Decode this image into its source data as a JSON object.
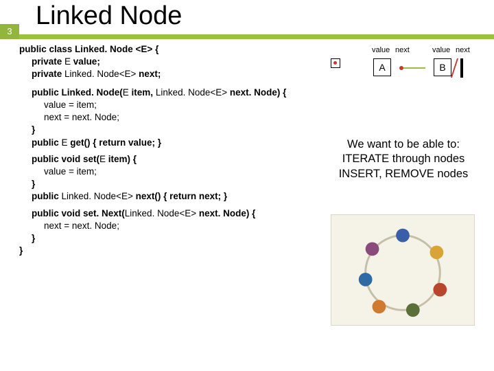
{
  "slide_number": "3",
  "title": "Linked Node",
  "code": {
    "class_decl": "public class Linked. Node <E> {",
    "field1_pre": "private ",
    "field1_type": "E ",
    "field1_post": "value;",
    "field2_pre": "private ",
    "field2_type": "Linked. Node<E> ",
    "field2_post": "next;",
    "ctor_pre": "public Linked. Node(",
    "ctor_p1t": "E ",
    "ctor_p1n": "item",
    "ctor_sep": ", ",
    "ctor_p2t": "Linked. Node<E> ",
    "ctor_p2n": "next. Node",
    "ctor_close": ") {",
    "ctor_b1": "value = item;",
    "ctor_b2": "next = next. Node;",
    "brace_close": "}",
    "get_pre": "public ",
    "get_type": "E ",
    "get_name": "get",
    "get_rest": "() { return value; }",
    "set_pre": "public void set(",
    "set_ptype": "E ",
    "set_pname": "item",
    "set_close": ") {",
    "set_body": "value = item;",
    "next_pre": "public ",
    "next_type": "Linked. Node<E> ",
    "next_name": "next",
    "next_rest": "() { return next; }",
    "setnext_pre": "public void set. Next(",
    "setnext_ptype": "Linked. Node<E> ",
    "setnext_pname": "next. Node",
    "setnext_close": ") {",
    "setnext_body": "next = next. Node;"
  },
  "diagram": {
    "label_value": "value",
    "label_next": "next",
    "nodeA": "A",
    "nodeB": "B"
  },
  "goals": {
    "line1": "We want to be able to:",
    "line2": "ITERATE through nodes",
    "line3": "INSERT, REMOVE nodes"
  }
}
